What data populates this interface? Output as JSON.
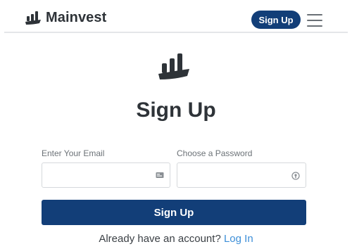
{
  "header": {
    "brand_name": "Mainvest",
    "signup_button": "Sign Up",
    "logo_icon": "mainvest-bars-logo",
    "menu_icon": "hamburger-icon"
  },
  "main": {
    "title": "Sign Up",
    "email": {
      "label": "Enter Your Email",
      "value": "",
      "placeholder": "",
      "icon": "id-card-icon"
    },
    "password": {
      "label": "Choose a Password",
      "value": "",
      "placeholder": "",
      "icon": "password-manager-icon"
    },
    "submit_label": "Sign Up",
    "login_prompt": "Already have an account?",
    "login_link": "Log In"
  },
  "colors": {
    "brand_navy": "#123e78",
    "link_blue": "#3d8fd8",
    "text_dark": "#2e3338"
  }
}
